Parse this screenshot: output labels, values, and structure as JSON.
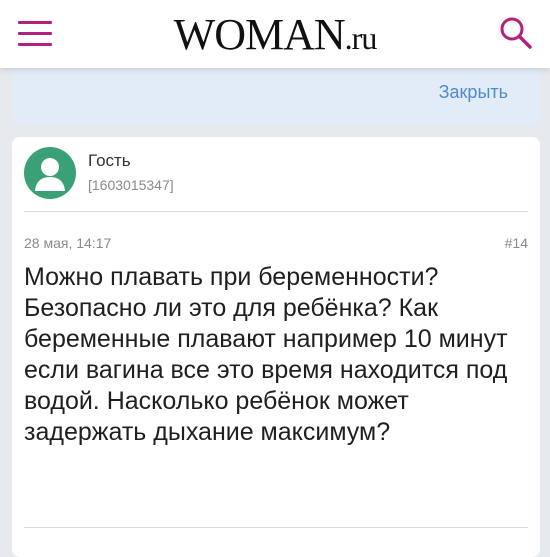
{
  "header": {
    "logo_caps": "WOMAN",
    "logo_small": ".ru"
  },
  "closed_block": {
    "close_label": "Закрыть"
  },
  "post": {
    "author_name": "Гость",
    "author_id": "[1603015347]",
    "date": "28 мая, 14:17",
    "number": "#14",
    "text": "Можно плавать при беременности? Безопасно ли это для ребёнка? Как беременные плавают например 10 минут если вагина все это время находится под водой. Насколько ребёнок может задержать дыхание максимум?"
  },
  "colors": {
    "accent": "#b3207e",
    "link": "#4f8ac9",
    "avatar_bg": "#3aa176",
    "closed_card_bg": "#e1ecf8"
  },
  "icons": {
    "menu": "hamburger-menu-icon",
    "search": "search-icon",
    "avatar": "user-silhouette-icon"
  }
}
